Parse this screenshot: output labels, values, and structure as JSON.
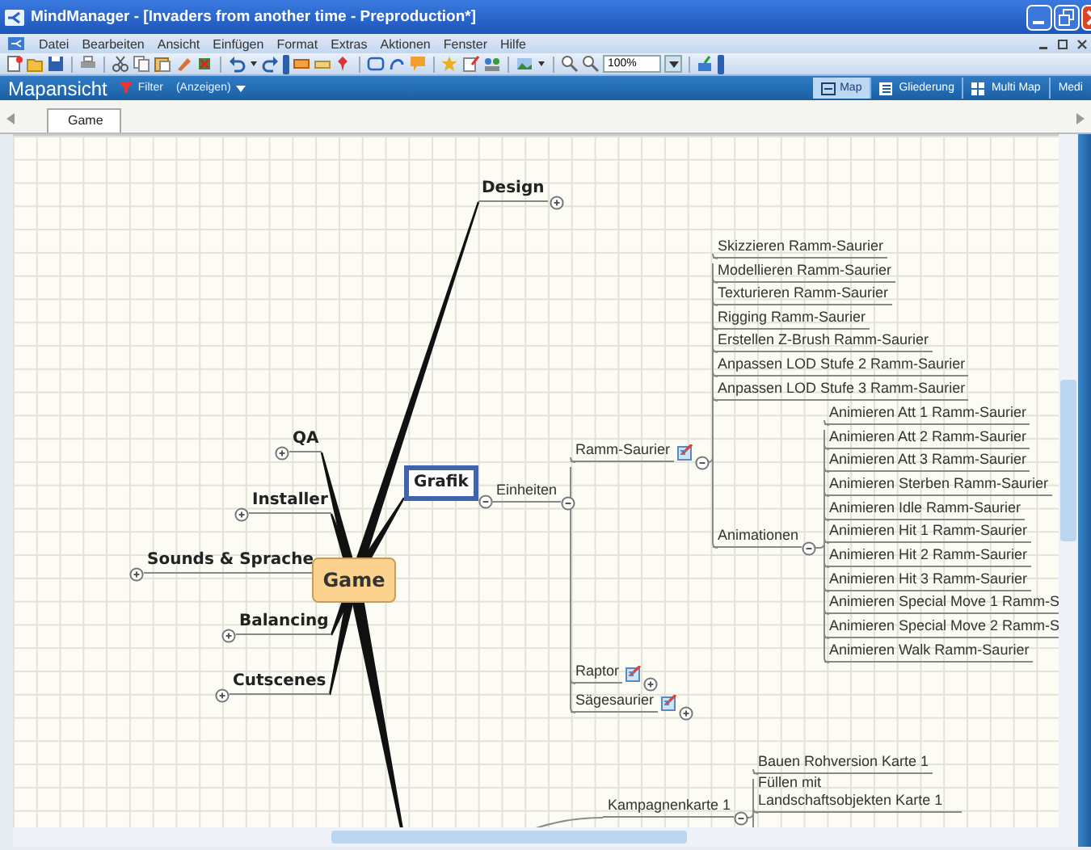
{
  "window": {
    "title": "MindManager - [Invaders from another time - Preproduction*]"
  },
  "menu": [
    "Datei",
    "Bearbeiten",
    "Ansicht",
    "Einfügen",
    "Format",
    "Extras",
    "Aktionen",
    "Fenster",
    "Hilfe"
  ],
  "toolbar": {
    "zoom": "100%"
  },
  "view_bar": {
    "title": "Mapansicht",
    "filter": "Filter",
    "show": "(Anzeigen)",
    "views": [
      {
        "label": "Map",
        "selected": true
      },
      {
        "label": "Gliederung",
        "selected": false
      },
      {
        "label": "Multi Map",
        "selected": false
      },
      {
        "label": "Medi",
        "selected": false
      }
    ]
  },
  "tabs": [
    {
      "label": "Game",
      "selected": true
    }
  ],
  "map": {
    "central": "Game",
    "topics": [
      {
        "label": "Design",
        "selected": false,
        "expanded": false
      },
      {
        "label": "QA",
        "selected": false,
        "expanded": false
      },
      {
        "label": "Installer",
        "selected": false,
        "expanded": false
      },
      {
        "label": "Sounds & Sprache",
        "selected": false,
        "expanded": false
      },
      {
        "label": "Balancing",
        "selected": false,
        "expanded": false
      },
      {
        "label": "Cutscenes",
        "selected": false,
        "expanded": false
      },
      {
        "label": "Grafik",
        "selected": true,
        "expanded": true,
        "children": [
          {
            "label": "Einheiten",
            "expanded": true,
            "children": [
              {
                "label": "Ramm-Saurier",
                "note": true,
                "expanded": true,
                "children": [
                  {
                    "label": "Skizzieren Ramm-Saurier"
                  },
                  {
                    "label": "Modellieren Ramm-Saurier"
                  },
                  {
                    "label": "Texturieren Ramm-Saurier"
                  },
                  {
                    "label": "Rigging Ramm-Saurier"
                  },
                  {
                    "label": "Erstellen Z-Brush Ramm-Saurier"
                  },
                  {
                    "label": "Anpassen LOD Stufe 2 Ramm-Saurier"
                  },
                  {
                    "label": "Anpassen LOD Stufe 3 Ramm-Saurier"
                  },
                  {
                    "label": "Animationen",
                    "expanded": true,
                    "children": [
                      {
                        "label": "Animieren Att 1 Ramm-Saurier"
                      },
                      {
                        "label": "Animieren Att 2 Ramm-Saurier"
                      },
                      {
                        "label": "Animieren Att 3 Ramm-Saurier"
                      },
                      {
                        "label": "Animieren Sterben Ramm-Saurier"
                      },
                      {
                        "label": "Animieren Idle Ramm-Saurier"
                      },
                      {
                        "label": "Animieren Hit 1 Ramm-Saurier"
                      },
                      {
                        "label": "Animieren Hit 2 Ramm-Saurier"
                      },
                      {
                        "label": "Animieren Hit 3 Ramm-Saurier"
                      },
                      {
                        "label": "Animieren Special Move 1 Ramm-S"
                      },
                      {
                        "label": "Animieren Special Move 2 Ramm-S"
                      },
                      {
                        "label": "Animieren Walk Ramm-Saurier"
                      }
                    ]
                  }
                ]
              },
              {
                "label": "Raptor",
                "note": true,
                "expanded": false
              },
              {
                "label": "Sägesaurier",
                "note": true,
                "expanded": false
              }
            ]
          }
        ]
      }
    ]
  },
  "partial_branch": {
    "label": "Kampagnenkarte 1",
    "expanded": true,
    "children": [
      {
        "label": "Bauen Rohversion Karte 1"
      },
      {
        "label": "Füllen mit Landschaftsobjekten Karte 1"
      }
    ]
  }
}
